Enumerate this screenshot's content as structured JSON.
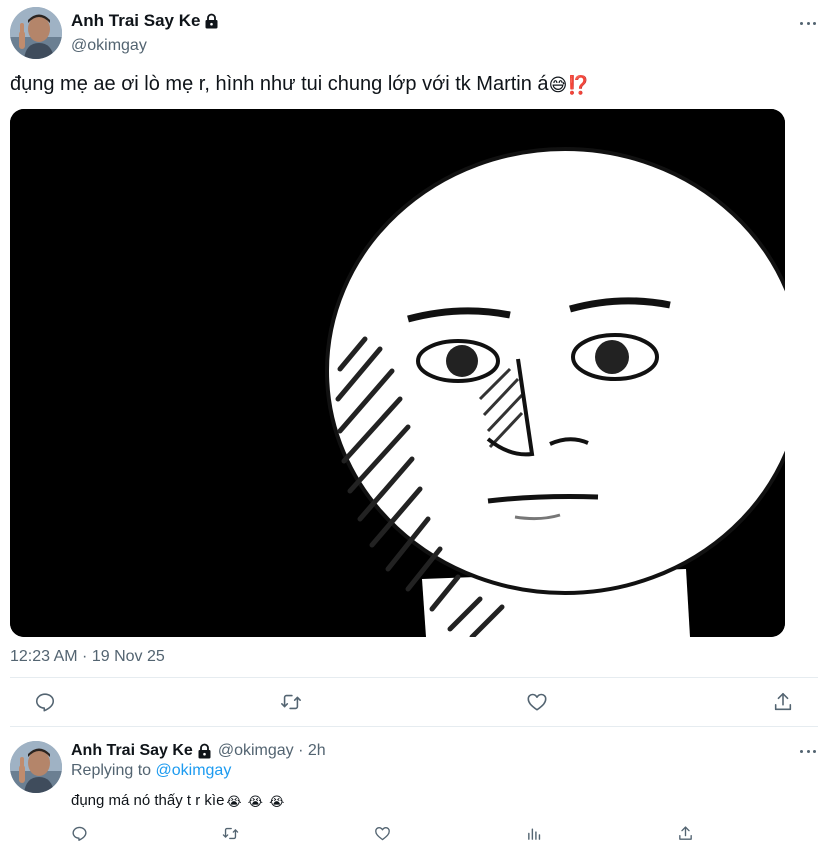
{
  "main_tweet": {
    "author_name": "Anh Trai Say Ke",
    "handle": "@okimgay",
    "text": "đụng mẹ ae ơi lò mẹ r, hình như tui chung lớp với tk Martin á",
    "emojis": [
      "😅",
      "⁉️"
    ],
    "timestamp": "12:23 AM · 19 Nov 25",
    "actions": [
      "reply-icon",
      "retweet-icon",
      "like-icon",
      "share-icon"
    ]
  },
  "reply": {
    "author_name": "Anh Trai Say Ke",
    "meta": "@okimgay · 2h",
    "replying_label": "Replying to",
    "replying_to": "@okimgay",
    "text": "đụng má nó thấy t r kìe",
    "emojis": [
      "😭",
      "😭",
      "😭"
    ],
    "actions": [
      "reply-icon",
      "retweet-icon",
      "like-icon",
      "analytics-icon",
      "share-icon"
    ]
  },
  "colors": {
    "text": "#0f1419",
    "secondary": "#536471",
    "link": "#1d9bf0",
    "divider": "#e6ecf0"
  }
}
